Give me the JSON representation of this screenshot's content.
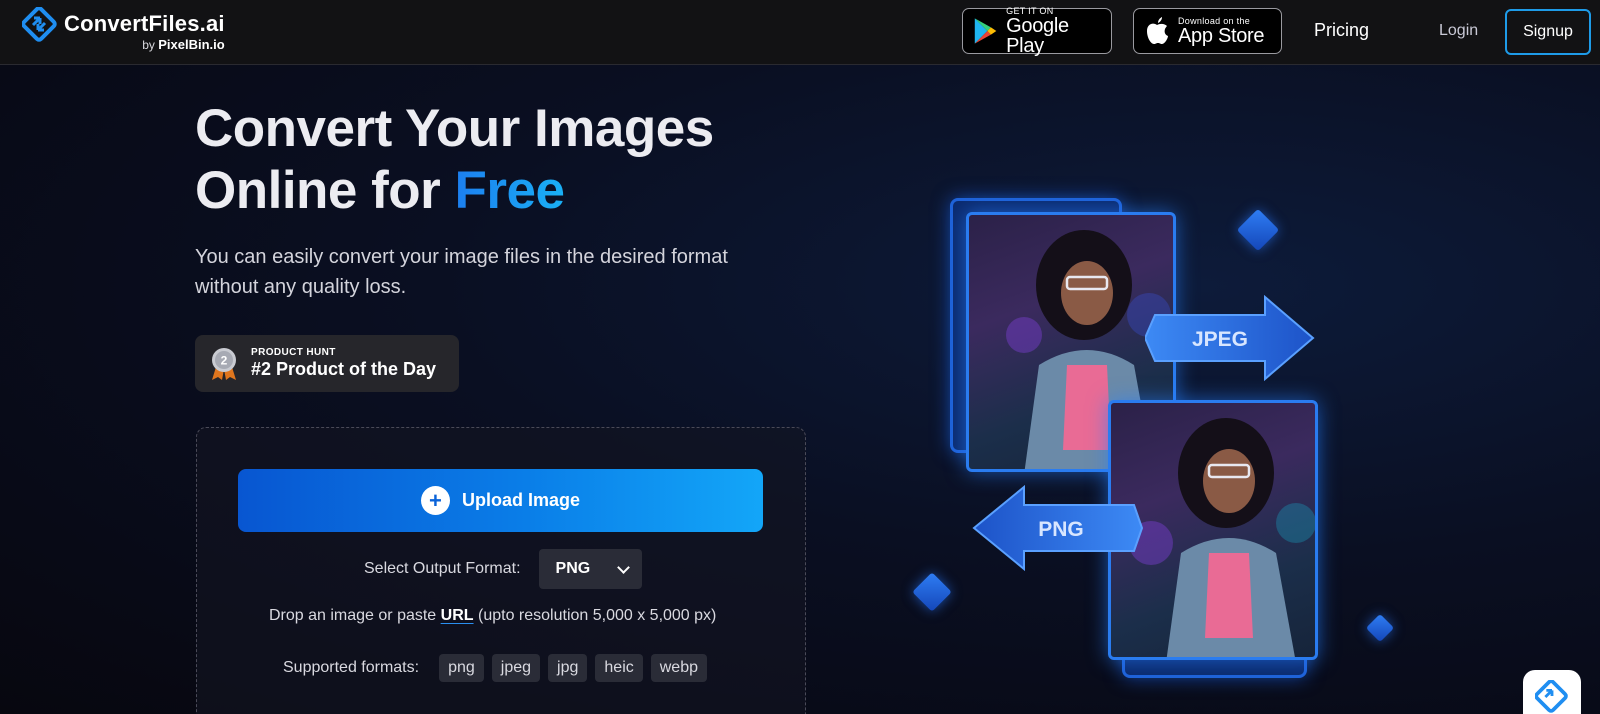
{
  "header": {
    "logo": {
      "title": "ConvertFiles.ai",
      "by_prefix": "by",
      "by_brand": "PixelBin.io"
    },
    "google_play": {
      "small": "GET IT ON",
      "big": "Google Play"
    },
    "app_store": {
      "small": "Download on the",
      "big": "App Store"
    },
    "nav": {
      "pricing": "Pricing",
      "login": "Login",
      "signup": "Signup"
    }
  },
  "hero": {
    "title_line1": "Convert Your Images",
    "title_line2_prefix": "Online for ",
    "title_accent": "Free",
    "subtitle": "You can easily convert your image files in the desired format without any quality loss."
  },
  "badge": {
    "medal_number": "2",
    "small": "PRODUCT HUNT",
    "big": "#2 Product of the Day"
  },
  "upload": {
    "button_label": "Upload Image",
    "format_label": "Select Output Format:",
    "format_value": "PNG",
    "drop_prefix": "Drop an image or paste",
    "drop_link": "URL",
    "drop_suffix": "(upto resolution 5,000 x 5,000 px)",
    "supported_label": "Supported formats:",
    "formats": [
      "png",
      "jpeg",
      "jpg",
      "heic",
      "webp"
    ]
  },
  "illustration": {
    "arrow_top_label": "JPEG",
    "arrow_bottom_label": "PNG"
  },
  "colors": {
    "accent": "#1c7ff0",
    "accent_light": "#13a6f8",
    "signup_border": "#1e9be8"
  }
}
